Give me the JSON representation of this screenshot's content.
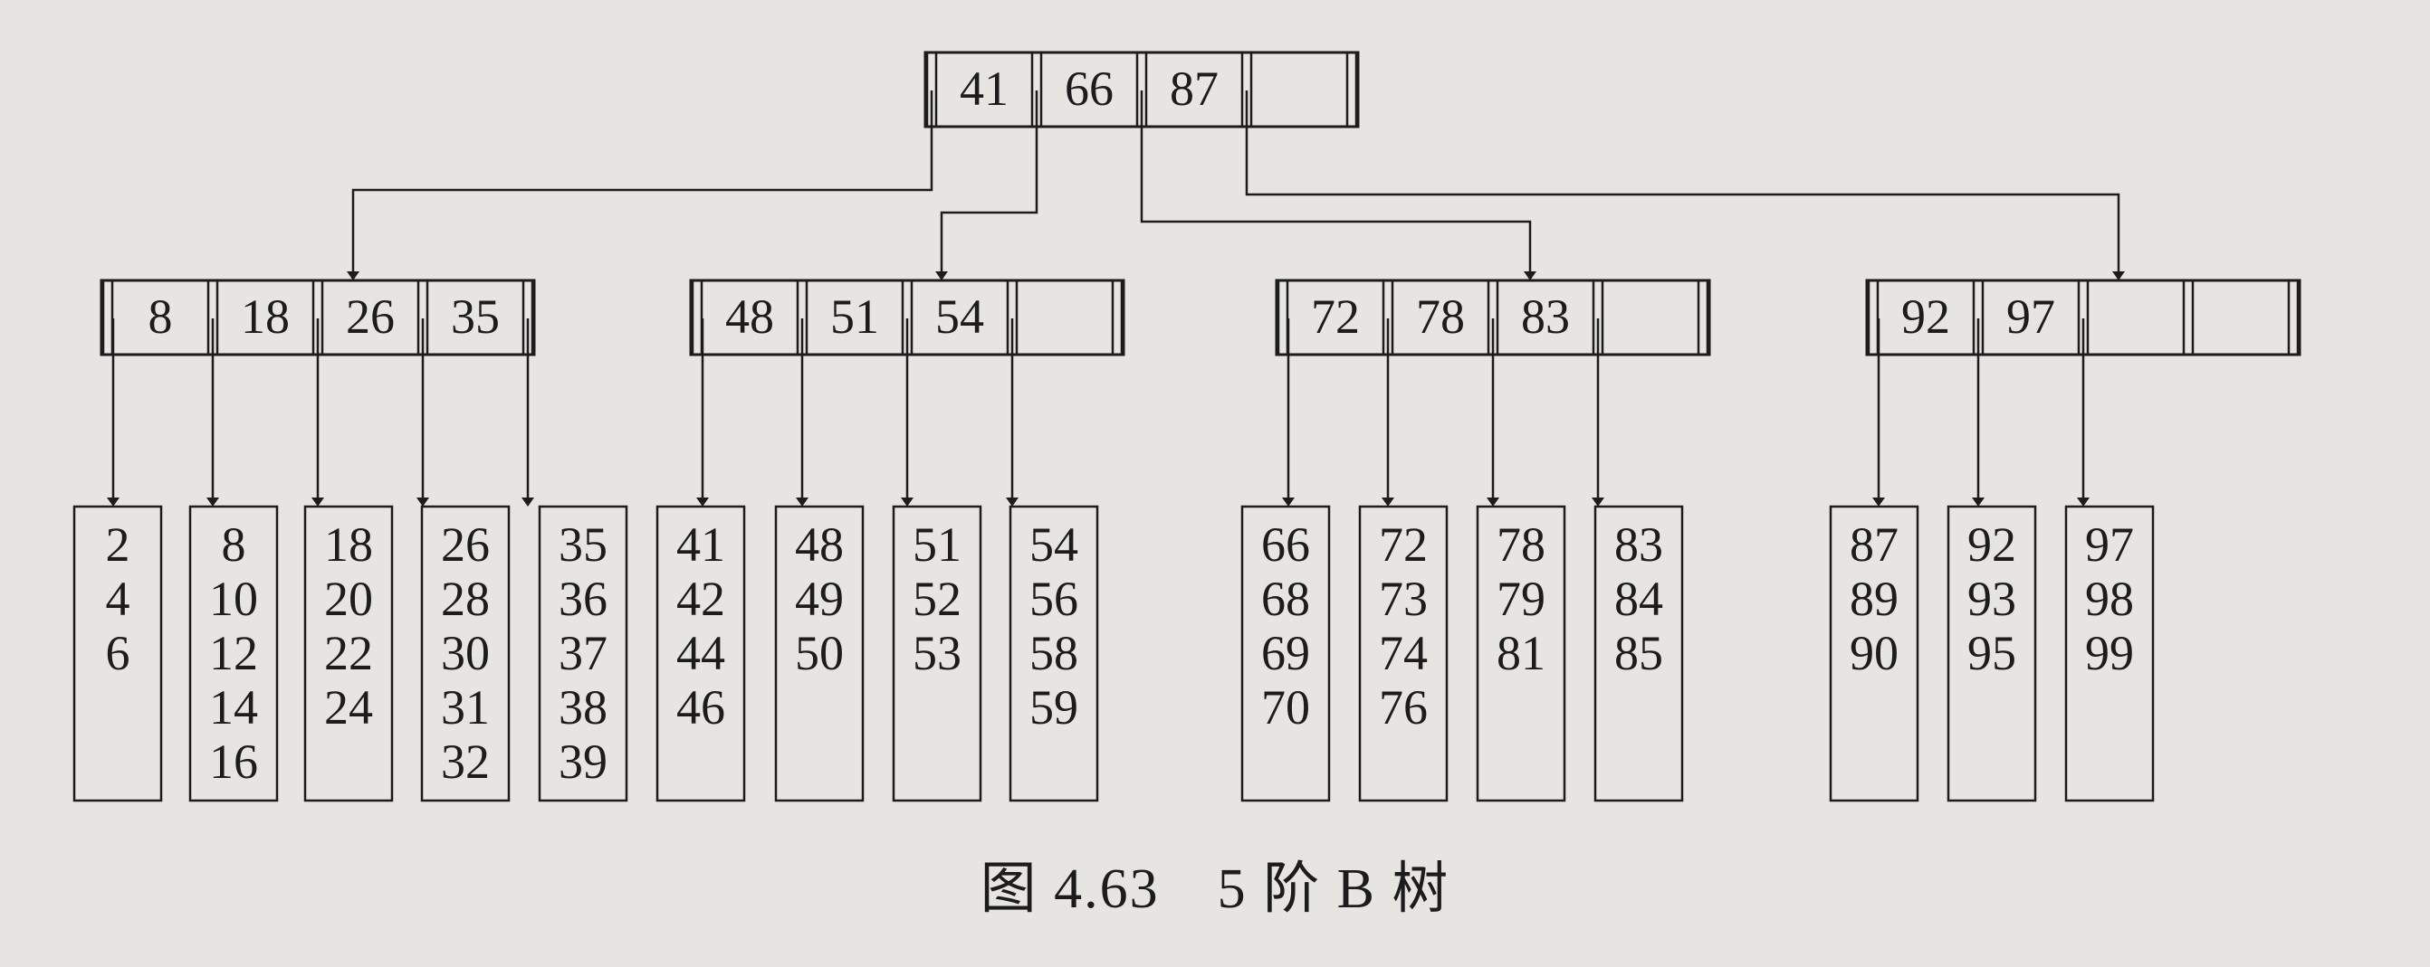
{
  "tree": {
    "root": {
      "keys": [
        "41",
        "66",
        "87",
        ""
      ]
    },
    "internal": [
      {
        "keys": [
          "8",
          "18",
          "26",
          "35"
        ]
      },
      {
        "keys": [
          "48",
          "51",
          "54",
          ""
        ]
      },
      {
        "keys": [
          "72",
          "78",
          "83",
          ""
        ]
      },
      {
        "keys": [
          "92",
          "97",
          "",
          ""
        ]
      }
    ],
    "leaves": [
      [
        "2",
        "4",
        "6"
      ],
      [
        "8",
        "10",
        "12",
        "14",
        "16"
      ],
      [
        "18",
        "20",
        "22",
        "24"
      ],
      [
        "26",
        "28",
        "30",
        "31",
        "32"
      ],
      [
        "35",
        "36",
        "37",
        "38",
        "39"
      ],
      [
        "41",
        "42",
        "44",
        "46"
      ],
      [
        "48",
        "49",
        "50"
      ],
      [
        "51",
        "52",
        "53"
      ],
      [
        "54",
        "56",
        "58",
        "59"
      ],
      [
        "66",
        "68",
        "69",
        "70"
      ],
      [
        "72",
        "73",
        "74",
        "76"
      ],
      [
        "78",
        "79",
        "81"
      ],
      [
        "83",
        "84",
        "85"
      ],
      [
        "87",
        "89",
        "90"
      ],
      [
        "92",
        "93",
        "95"
      ],
      [
        "97",
        "98",
        "99"
      ]
    ]
  },
  "caption": "图 4.63　5 阶 B 树",
  "colors": {
    "ink": "#1c1c1c",
    "paper": "#e6e5e1"
  }
}
